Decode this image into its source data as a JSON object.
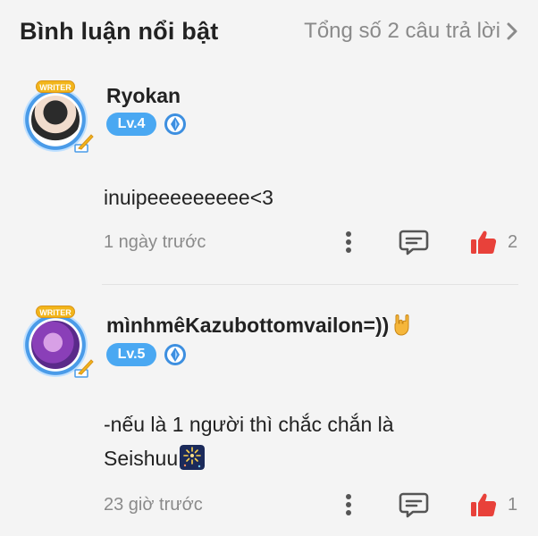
{
  "header": {
    "title": "Bình luận nổi bật",
    "total_link": "Tổng số 2 câu trả lời"
  },
  "colors": {
    "like_red": "#e8413a",
    "level_blue": "#4aa8f2",
    "muted_gray": "#8a8a8a",
    "writer_gold": "#f2b51a"
  },
  "comments": [
    {
      "username": "Ryokan",
      "badge": "WRITER",
      "level": "Lv.4",
      "text": "inuipeeeeeeeee<3",
      "time": "1 ngày trước",
      "likes": "2",
      "icons": [
        "more-vertical-icon",
        "reply-icon",
        "thumbs-up-icon",
        "gem-badge-icon"
      ]
    },
    {
      "username": "mìnhmêKazubottomvailon=))",
      "username_emoji": "sign-of-the-horns-emoji",
      "badge": "WRITER",
      "level": "Lv.5",
      "text_line1": "-nếu là 1 người thì chắc chắn là",
      "text_line2": "Seishuu",
      "text_emoji": "fireworks-emoji",
      "time": "23 giờ trước",
      "likes": "1",
      "icons": [
        "more-vertical-icon",
        "reply-icon",
        "thumbs-up-icon",
        "gem-badge-icon"
      ]
    }
  ]
}
